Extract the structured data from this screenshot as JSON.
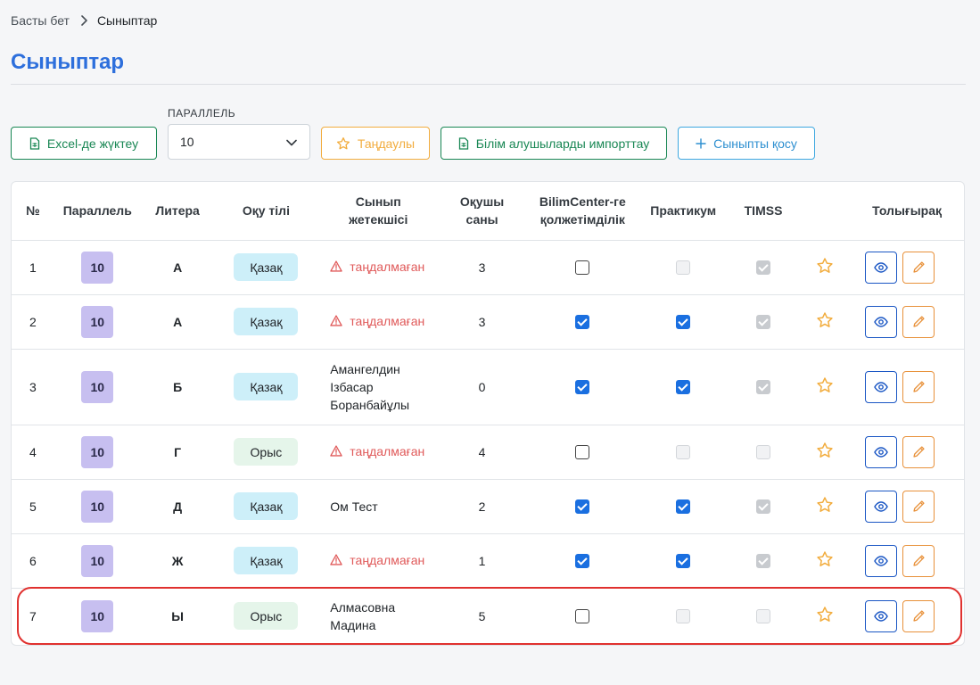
{
  "breadcrumb": {
    "home": "Басты бет",
    "current": "Сыныптар"
  },
  "page": {
    "title": "Сыныптар"
  },
  "toolbar": {
    "excel_label": "Excel-де жүктеу",
    "parallel_label": "ПАРАЛЛЕЛЬ",
    "parallel_value": "10",
    "favorites_label": "Таңдаулы",
    "import_label": "Білім алушыларды импорттау",
    "add_label": "Сыныпты қосу"
  },
  "colors": {
    "accent": "#2d6fdc",
    "green": "#198754",
    "yellow": "#f2ad3f",
    "warning": "#e05a5a",
    "highlight": "#e0312f"
  },
  "table": {
    "headers": {
      "num": "№",
      "parallel": "Параллель",
      "litera": "Литера",
      "lang": "Оқу тілі",
      "leader_1": "Сынып",
      "leader_2": "жетекшісі",
      "count_1": "Оқушы",
      "count_2": "саны",
      "bilim_1": "BilimCenter-ге",
      "bilim_2": "қолжетімділік",
      "praktikum": "Практикум",
      "timss": "TIMSS",
      "details": "Толығырақ"
    },
    "rows": [
      {
        "num": "1",
        "parallel": "10",
        "litera": "А",
        "lang": "Қазақ",
        "lang_kind": "kz",
        "leader": [
          "таңдалмаған"
        ],
        "leader_missing": true,
        "count": "3",
        "bilim": false,
        "praktikum": "disabled",
        "timss": "disabled-checked"
      },
      {
        "num": "2",
        "parallel": "10",
        "litera": "А",
        "lang": "Қазақ",
        "lang_kind": "kz",
        "leader": [
          "таңдалмаған"
        ],
        "leader_missing": true,
        "count": "3",
        "bilim": true,
        "praktikum": "checked",
        "timss": "disabled-checked"
      },
      {
        "num": "3",
        "parallel": "10",
        "litera": "Б",
        "lang": "Қазақ",
        "lang_kind": "kz",
        "leader": [
          "Амангелдин",
          "Ізбасар",
          "Боранбайұлы"
        ],
        "leader_missing": false,
        "count": "0",
        "bilim": true,
        "praktikum": "checked",
        "timss": "disabled-checked"
      },
      {
        "num": "4",
        "parallel": "10",
        "litera": "Г",
        "lang": "Орыс",
        "lang_kind": "ru",
        "leader": [
          "таңдалмаған"
        ],
        "leader_missing": true,
        "count": "4",
        "bilim": false,
        "praktikum": "disabled",
        "timss": "disabled"
      },
      {
        "num": "5",
        "parallel": "10",
        "litera": "Д",
        "lang": "Қазақ",
        "lang_kind": "kz",
        "leader": [
          "Ом Тест"
        ],
        "leader_missing": false,
        "count": "2",
        "bilim": true,
        "praktikum": "checked",
        "timss": "disabled-checked"
      },
      {
        "num": "6",
        "parallel": "10",
        "litera": "Ж",
        "lang": "Қазақ",
        "lang_kind": "kz",
        "leader": [
          "таңдалмаған"
        ],
        "leader_missing": true,
        "count": "1",
        "bilim": true,
        "praktikum": "checked",
        "timss": "disabled-checked"
      },
      {
        "num": "7",
        "parallel": "10",
        "litera": "Ы",
        "lang": "Орыс",
        "lang_kind": "ru",
        "leader": [
          "Алмасовна",
          "Мадина"
        ],
        "leader_missing": false,
        "count": "5",
        "bilim": false,
        "praktikum": "disabled",
        "timss": "disabled",
        "highlighted": true
      }
    ]
  }
}
